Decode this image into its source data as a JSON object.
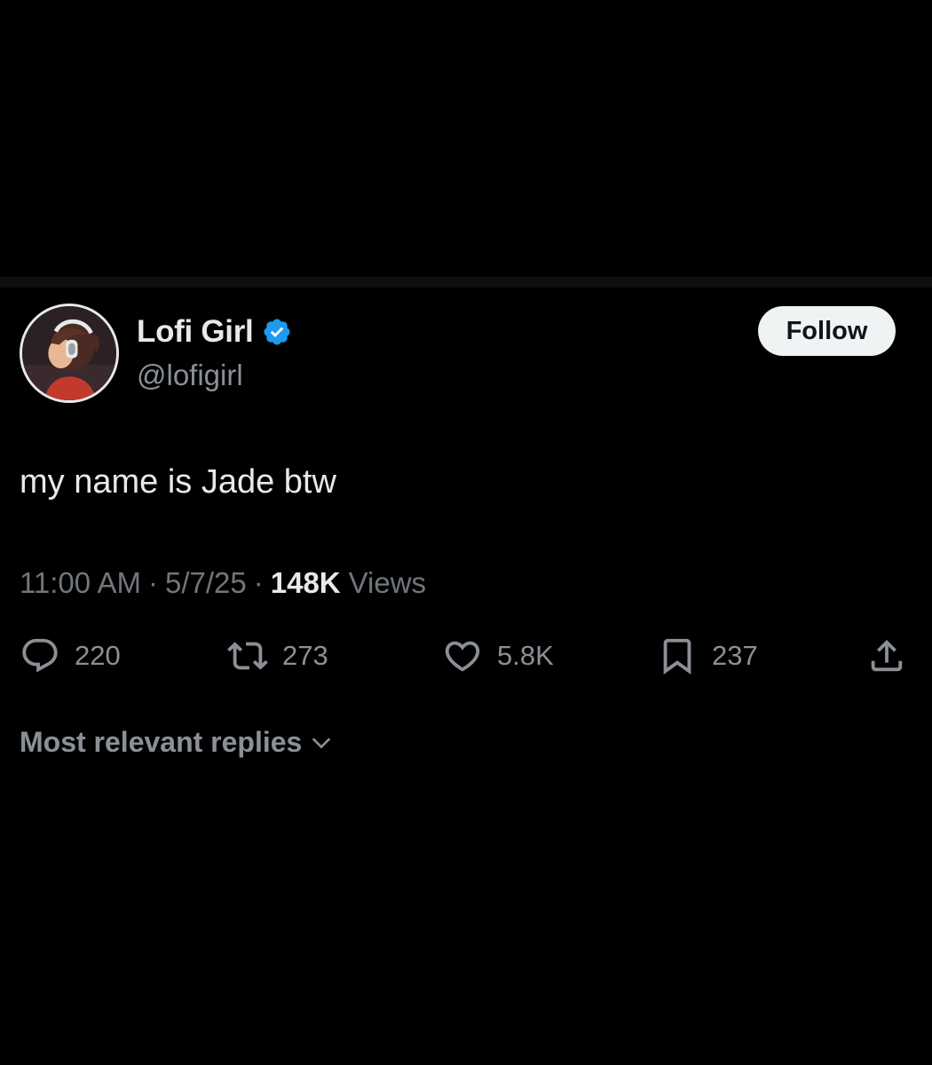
{
  "user": {
    "display_name": "Lofi Girl",
    "handle": "@lofigirl",
    "verified": true,
    "avatar_icon": "lofi-girl-avatar"
  },
  "follow_button": {
    "label": "Follow"
  },
  "tweet": {
    "text": "my name is Jade btw",
    "time": "11:00 AM",
    "separator": "·",
    "date": "5/7/25",
    "views_count": "148K",
    "views_label": "Views"
  },
  "actions": {
    "reply": {
      "icon": "reply-icon",
      "count": "220"
    },
    "repost": {
      "icon": "repost-icon",
      "count": "273"
    },
    "like": {
      "icon": "heart-icon",
      "count": "5.8K"
    },
    "bookmark": {
      "icon": "bookmark-icon",
      "count": "237"
    },
    "share": {
      "icon": "share-icon"
    }
  },
  "replies_sort": {
    "label": "Most relevant replies",
    "icon": "chevron-down-icon"
  },
  "colors": {
    "background": "#000000",
    "primary_text": "#e7e9ea",
    "secondary_text": "#71767b",
    "verified_blue": "#1d9bf0",
    "follow_button_bg": "#eff3f4"
  }
}
